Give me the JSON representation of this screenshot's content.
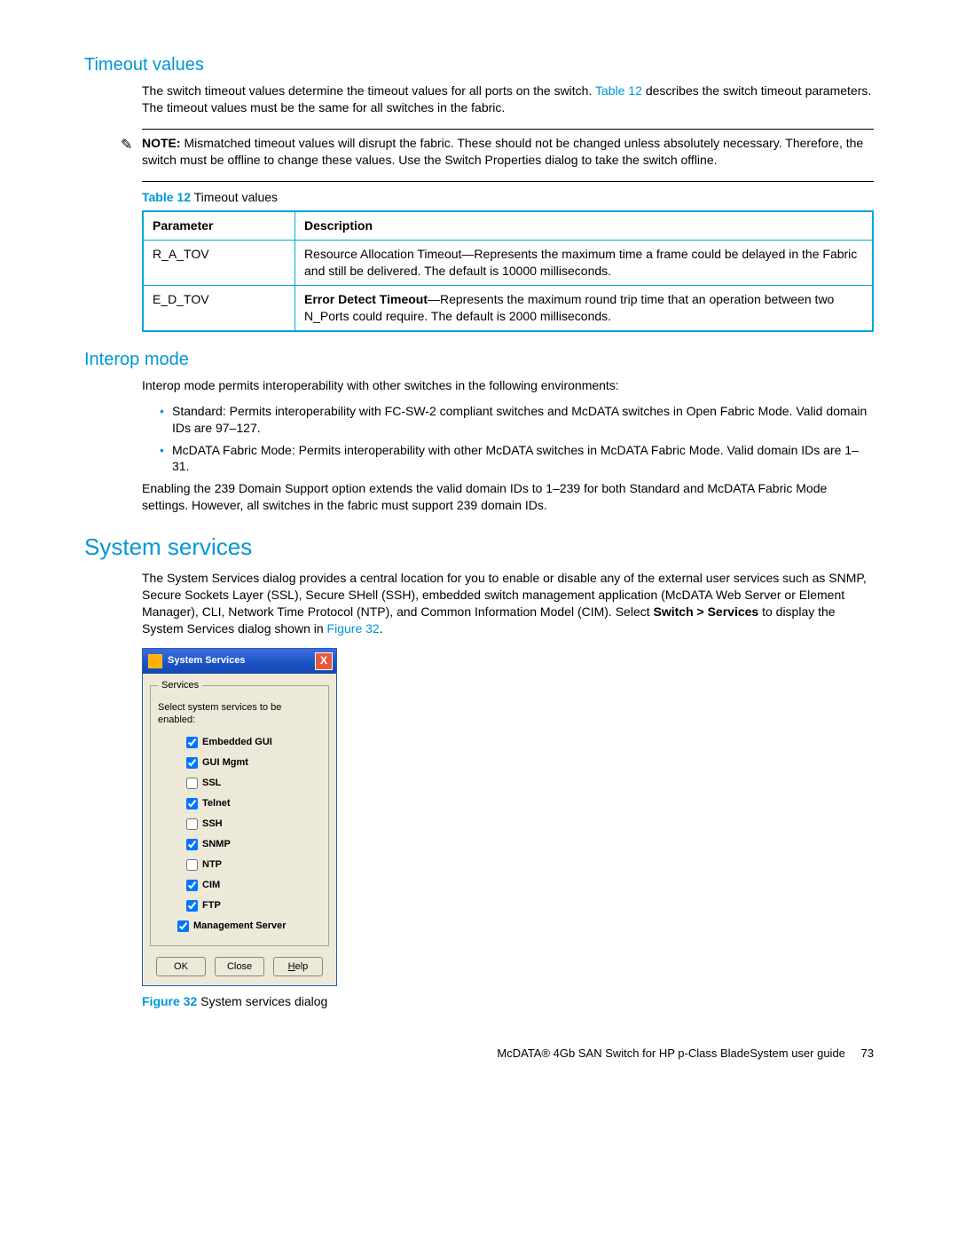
{
  "headings": {
    "timeout": "Timeout values",
    "interop": "Interop mode",
    "system": "System services"
  },
  "timeout": {
    "intro_a": "The switch timeout values determine the timeout values for all ports on the switch. ",
    "intro_link": "Table 12",
    "intro_b": " describes the switch timeout parameters. The timeout values must be the same for all switches in the fabric.",
    "note_label": "NOTE:",
    "note_text": " Mismatched timeout values will disrupt the fabric. These should not be changed unless absolutely necessary. Therefore, the switch must be offline to change these values. Use the Switch Properties dialog to take the switch offline.",
    "table_label": "Table 12",
    "table_title": " Timeout values",
    "th_param": "Parameter",
    "th_desc": "Description",
    "rows": [
      {
        "param": "R_A_TOV",
        "desc": "Resource Allocation Timeout—Represents the maximum time a frame could be delayed in the Fabric and still be delivered. The default is 10000 milliseconds."
      },
      {
        "param": "E_D_TOV",
        "bold": "Error Detect Timeout",
        "desc": "—Represents the maximum round trip time that an operation between two N_Ports could require. The default is 2000 milliseconds."
      }
    ]
  },
  "interop": {
    "intro": "Interop mode permits interoperability with other switches in the following environments:",
    "bullets": [
      "Standard: Permits interoperability with FC-SW-2 compliant switches and McDATA switches in Open Fabric Mode. Valid domain IDs are 97–127.",
      "McDATA Fabric Mode: Permits interoperability with other McDATA switches in McDATA Fabric Mode. Valid domain IDs are 1–31."
    ],
    "tail": "Enabling the 239 Domain Support option extends the valid domain IDs to 1–239 for both Standard and McDATA Fabric Mode settings. However, all switches in the fabric must support 239 domain IDs."
  },
  "system": {
    "p1a": "The System Services dialog provides a central location for you to enable or disable any of the external user services such as SNMP, Secure Sockets Layer (SSL), Secure SHell (SSH), embedded switch management application (McDATA Web Server or Element Manager), CLI, Network Time Protocol (NTP), and Common Information Model (CIM). Select ",
    "menu": "Switch > Services",
    "p1b": " to display the System Services dialog shown in ",
    "fig_link": "Figure 32",
    "p1c": "."
  },
  "dialog": {
    "title": "System Services",
    "title_close": "X",
    "legend": "Services",
    "prompt": "Select system services to be enabled:",
    "items": [
      {
        "label": "Embedded GUI",
        "checked": true
      },
      {
        "label": "GUI Mgmt",
        "checked": true
      },
      {
        "label": "SSL",
        "checked": false
      },
      {
        "label": "Telnet",
        "checked": true
      },
      {
        "label": "SSH",
        "checked": false
      },
      {
        "label": "SNMP",
        "checked": true
      },
      {
        "label": "NTP",
        "checked": false
      },
      {
        "label": "CIM",
        "checked": true
      },
      {
        "label": "FTP",
        "checked": true
      },
      {
        "label": "Management Server",
        "checked": true
      }
    ],
    "buttons": {
      "ok": "OK",
      "close": "Close",
      "help": "Help",
      "help_mn": "H"
    }
  },
  "figure": {
    "label": "Figure 32",
    "caption": " System services dialog"
  },
  "footer": {
    "text": "McDATA® 4Gb SAN Switch for HP p-Class BladeSystem user guide",
    "page": "73"
  }
}
